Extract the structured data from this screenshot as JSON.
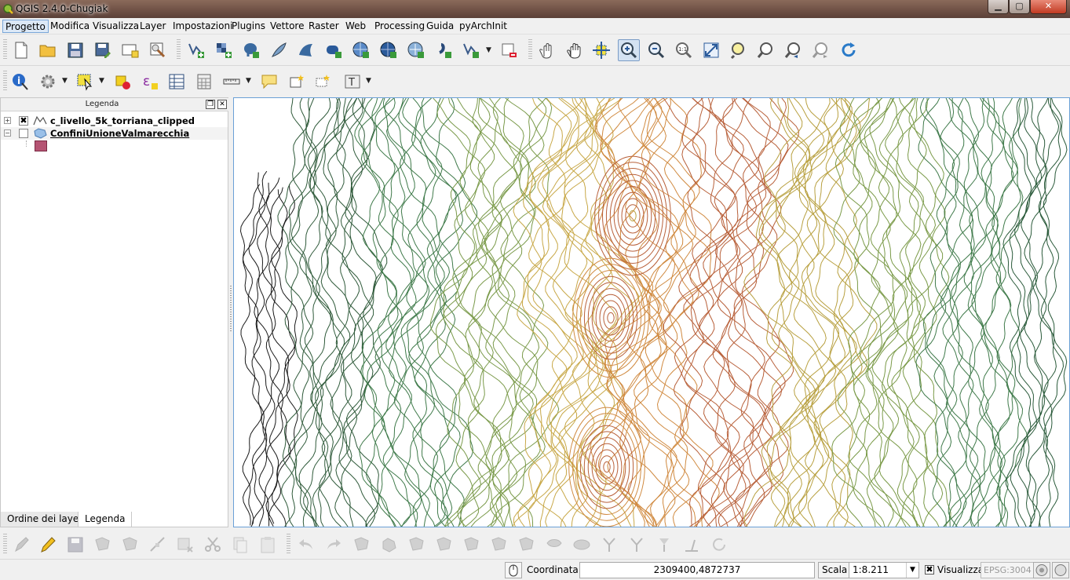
{
  "window": {
    "title": "QGIS 2.4.0-Chugiak",
    "minimize": "▁",
    "maximize": "▢",
    "close": "✕"
  },
  "menu": [
    "Progetto",
    "Modifica",
    "Visualizza",
    "Layer",
    "Impostazioni",
    "Plugins",
    "Vettore",
    "Raster",
    "Web",
    "Processing",
    "Guida",
    "pyArchInit"
  ],
  "legend": {
    "title": "Legenda",
    "layers": [
      {
        "name": "c_livello_5k_torriana_clipped",
        "checked": true,
        "expanded": false
      },
      {
        "name": "ConfiniUnioneValmarecchia",
        "checked": false,
        "expanded": true,
        "symbol_color": "#b55473"
      }
    ]
  },
  "tabs": [
    "Ordine dei layer",
    "Legenda"
  ],
  "status": {
    "coord_label": "Coordinata:",
    "coord_value": "2309400,4872737",
    "scale_label": "Scala",
    "scale_value": "1:8.211",
    "render_label": "Visualizza",
    "render_checked": true,
    "epsg": "EPSG:3004"
  },
  "map": {
    "contour_colors": [
      "#1a1a1a",
      "#2f5a3a",
      "#3f7a4a",
      "#7a9a4a",
      "#c8a848",
      "#d08a40",
      "#b8603a",
      "#b8a040",
      "#7a9a48",
      "#3f7a4a",
      "#2a5a3a"
    ]
  }
}
